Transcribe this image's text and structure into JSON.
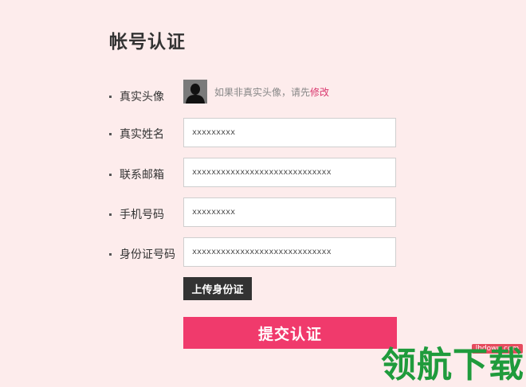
{
  "page": {
    "title": "帐号认证"
  },
  "form": {
    "avatar": {
      "label": "真实头像",
      "hint": "如果非真实头像，请先",
      "link": "修改"
    },
    "fields": [
      {
        "label": "真实姓名",
        "value": "xxxxxxxxx"
      },
      {
        "label": "联系邮箱",
        "value": "xxxxxxxxxxxxxxxxxxxxxxxxxxxxx"
      },
      {
        "label": "手机号码",
        "value": "xxxxxxxxx"
      },
      {
        "label": "身份证号码",
        "value": "xxxxxxxxxxxxxxxxxxxxxxxxxxxxx"
      }
    ],
    "upload_label": "上传身份证",
    "submit_label": "提交认证"
  },
  "watermark": {
    "site": "lhdown.com",
    "text": "领航下载"
  },
  "colors": {
    "background": "#fdecec",
    "accent": "#f03a6c",
    "link": "#d9376e",
    "upload_button": "#333333",
    "watermark_green": "#1f9b3c"
  }
}
